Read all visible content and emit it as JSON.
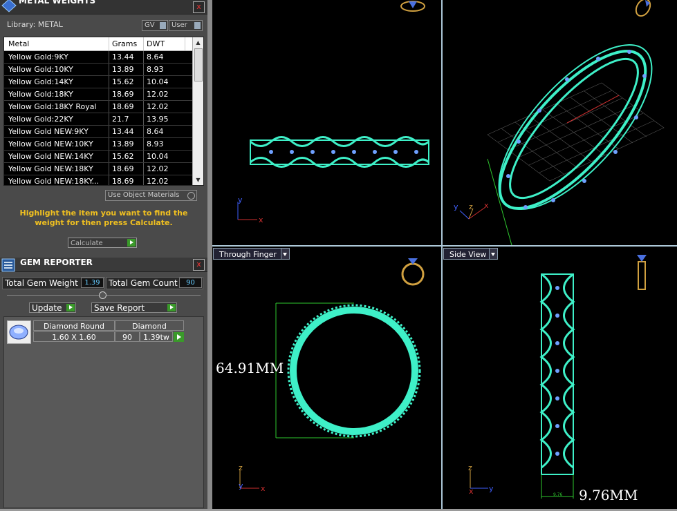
{
  "metal_panel": {
    "title": "METAL WEIGHTS",
    "close": "x",
    "library_label": "Library: METAL",
    "gv_label": "GV",
    "user_label": "User",
    "columns": [
      "Metal",
      "Grams",
      "DWT"
    ],
    "rows": [
      [
        "Yellow Gold:9KY",
        "13.44",
        "8.64"
      ],
      [
        "Yellow Gold:10KY",
        "13.89",
        "8.93"
      ],
      [
        "Yellow Gold:14KY",
        "15.62",
        "10.04"
      ],
      [
        "Yellow Gold:18KY",
        "18.69",
        "12.02"
      ],
      [
        "Yellow Gold:18KY Royal",
        "18.69",
        "12.02"
      ],
      [
        "Yellow Gold:22KY",
        "21.7",
        "13.95"
      ],
      [
        "Yellow Gold NEW:9KY",
        "13.44",
        "8.64"
      ],
      [
        "Yellow Gold NEW:10KY",
        "13.89",
        "8.93"
      ],
      [
        "Yellow Gold NEW:14KY",
        "15.62",
        "10.04"
      ],
      [
        "Yellow Gold NEW:18KY",
        "18.69",
        "12.02"
      ],
      [
        "Yellow Gold NEW:18KY...",
        "18.69",
        "12.02"
      ]
    ],
    "use_object_materials": "Use Object Materials",
    "hint": "Highlight the item you want to find the weight for then press Calculate.",
    "calculate_label": "Calculate"
  },
  "gem_panel": {
    "title": "GEM REPORTER",
    "close": "x",
    "total_weight_label": "Total Gem Weight",
    "total_weight_value": "1.39",
    "total_count_label": "Total Gem Count",
    "total_count_value": "90",
    "update_label": "Update",
    "save_report_label": "Save Report",
    "gem": {
      "shape": "Diamond Round",
      "size": "1.60 X 1.60",
      "material": "Diamond",
      "count": "90",
      "weight": "1.39tw"
    }
  },
  "viewports": {
    "bottom_left_view": "Through Finger",
    "bottom_right_view": "Side View",
    "diameter_label": "64.91MM",
    "width_label": "9.76MM",
    "width_small": "9.76",
    "axes": {
      "top_left": [
        "y",
        "x"
      ],
      "top_right": [
        "y",
        "z",
        "x"
      ],
      "bottom_left": [
        "z",
        "y",
        "x"
      ],
      "bottom_right": [
        "z",
        "x",
        "y"
      ]
    }
  },
  "colors": {
    "ring": "#3ef0c8",
    "gem": "#6fa0ff",
    "guide": "#2ec82e",
    "hint": "#f0c020",
    "axis_red": "#d03030",
    "axis_blue": "#4060ff",
    "axis_yellow": "#d0a040"
  }
}
